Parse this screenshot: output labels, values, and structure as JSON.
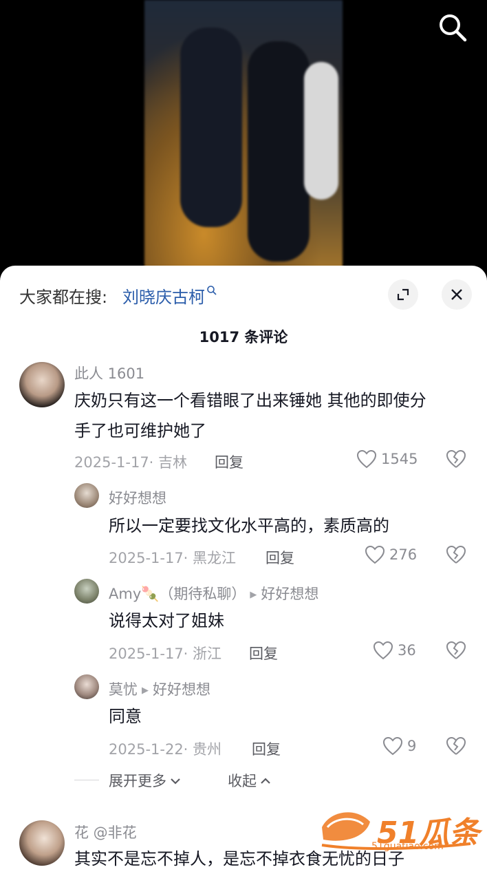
{
  "video": {},
  "search_icon": "search-icon",
  "sheet": {
    "trending_label": "大家都在搜:",
    "trending_query": "刘晓庆古柯",
    "comment_count": "1017 条评论"
  },
  "comments": [
    {
      "user": "此人 1601",
      "text_line1": "庆奶只有这一个看错眼了出来锤她 其他的即使分",
      "text_line2": "手了也可维护她了",
      "meta": "2025-1-17· 吉林",
      "reply": "回复",
      "likes": "1545"
    },
    {
      "user": "好好想想",
      "text": "所以一定要找文化水平高的，素质高的",
      "meta": "2025-1-17· 黑龙江",
      "reply": "回复",
      "likes": "276"
    },
    {
      "user": "Amy🍡（期待私聊）",
      "reply_to": "好好想想",
      "text": "说得太对了姐妹",
      "meta": "2025-1-17· 浙江",
      "reply": "回复",
      "likes": "36"
    },
    {
      "user": "莫忧",
      "reply_to": "好好想想",
      "text": "同意",
      "meta": "2025-1-22· 贵州",
      "reply": "回复",
      "likes": "9"
    },
    {
      "user": "花 @非花",
      "text": "其实不是忘不掉人，是忘不掉衣食无忧的日子"
    }
  ],
  "thread": {
    "expand_more": "展开更多",
    "collapse": "收起"
  },
  "watermark": {
    "brand": "51瓜条",
    "site": "51guatiao.com"
  }
}
